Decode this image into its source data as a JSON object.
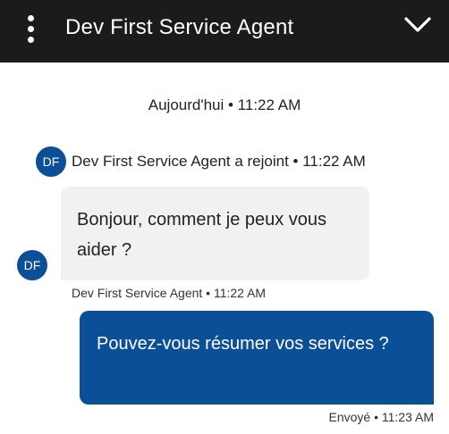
{
  "header": {
    "title": "Dev First Service Agent",
    "menu_icon": "vertical-ellipsis-icon",
    "collapse_icon": "chevron-down-icon",
    "background": "#1b1b1b"
  },
  "chat": {
    "date_divider": "Aujourd'hui • 11:22 AM",
    "joined": {
      "avatar_initials": "DF",
      "text": "Dev First Service Agent a rejoint • 11:22 AM"
    },
    "messages": [
      {
        "sender": "agent",
        "avatar_initials": "DF",
        "text": "Bonjour, comment je peux vous aider ?",
        "meta": "Dev First Service Agent • 11:22 AM"
      },
      {
        "sender": "user",
        "text": "Pouvez-vous résumer vos services ?",
        "meta": "Envoyé • 11:23 AM"
      }
    ]
  },
  "colors": {
    "accent": "#0a4f97",
    "agent_bubble": "#f1f1f1"
  }
}
